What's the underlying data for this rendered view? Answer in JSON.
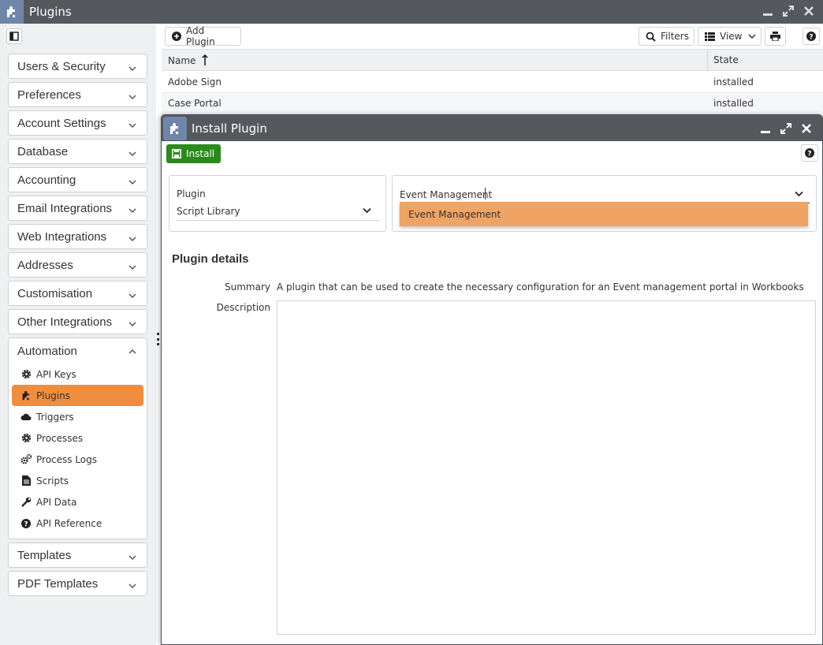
{
  "window": {
    "title": "Plugins",
    "icon": "puzzle-icon"
  },
  "sidebar": {
    "groups_before": [
      {
        "label": "Users & Security"
      },
      {
        "label": "Preferences"
      },
      {
        "label": "Account Settings"
      },
      {
        "label": "Database"
      },
      {
        "label": "Accounting"
      },
      {
        "label": "Email Integrations"
      },
      {
        "label": "Web Integrations"
      },
      {
        "label": "Addresses"
      },
      {
        "label": "Customisation"
      },
      {
        "label": "Other Integrations"
      }
    ],
    "open_group": {
      "label": "Automation",
      "items": [
        {
          "label": "API Keys",
          "icon": "gear-icon",
          "active": false
        },
        {
          "label": "Plugins",
          "icon": "puzzle-icon",
          "active": true
        },
        {
          "label": "Triggers",
          "icon": "cloud-icon",
          "active": false
        },
        {
          "label": "Processes",
          "icon": "gear-icon",
          "active": false
        },
        {
          "label": "Process Logs",
          "icon": "gears-icon",
          "active": false
        },
        {
          "label": "Scripts",
          "icon": "file-icon",
          "active": false
        },
        {
          "label": "API Data",
          "icon": "wrench-icon",
          "active": false
        },
        {
          "label": "API Reference",
          "icon": "question-icon",
          "active": false
        }
      ]
    },
    "groups_after": [
      {
        "label": "Templates"
      },
      {
        "label": "PDF Templates"
      }
    ]
  },
  "toolbar": {
    "add_plugin": "Add Plugin",
    "filters": "Filters",
    "view": "View"
  },
  "grid": {
    "columns": {
      "name": "Name",
      "state": "State"
    },
    "rows": [
      {
        "name": "Adobe Sign",
        "state": "installed"
      },
      {
        "name": "Case Portal",
        "state": "installed"
      }
    ]
  },
  "dialog": {
    "title": "Install Plugin",
    "install_label": "Install",
    "plugin_label": "Plugin",
    "plugin_value": "Script Library",
    "selected_value": "Event Management",
    "dropdown_option": "Event Management",
    "section_title": "Plugin details",
    "summary_label": "Summary",
    "summary_text": "A plugin that can be used to create the necessary configuration for an Event management portal in Workbooks",
    "description_label": "Description",
    "description_text": ""
  },
  "colors": {
    "accent": "#ef8e3f",
    "install": "#2a8a1b",
    "titlebar": "#55595e"
  }
}
